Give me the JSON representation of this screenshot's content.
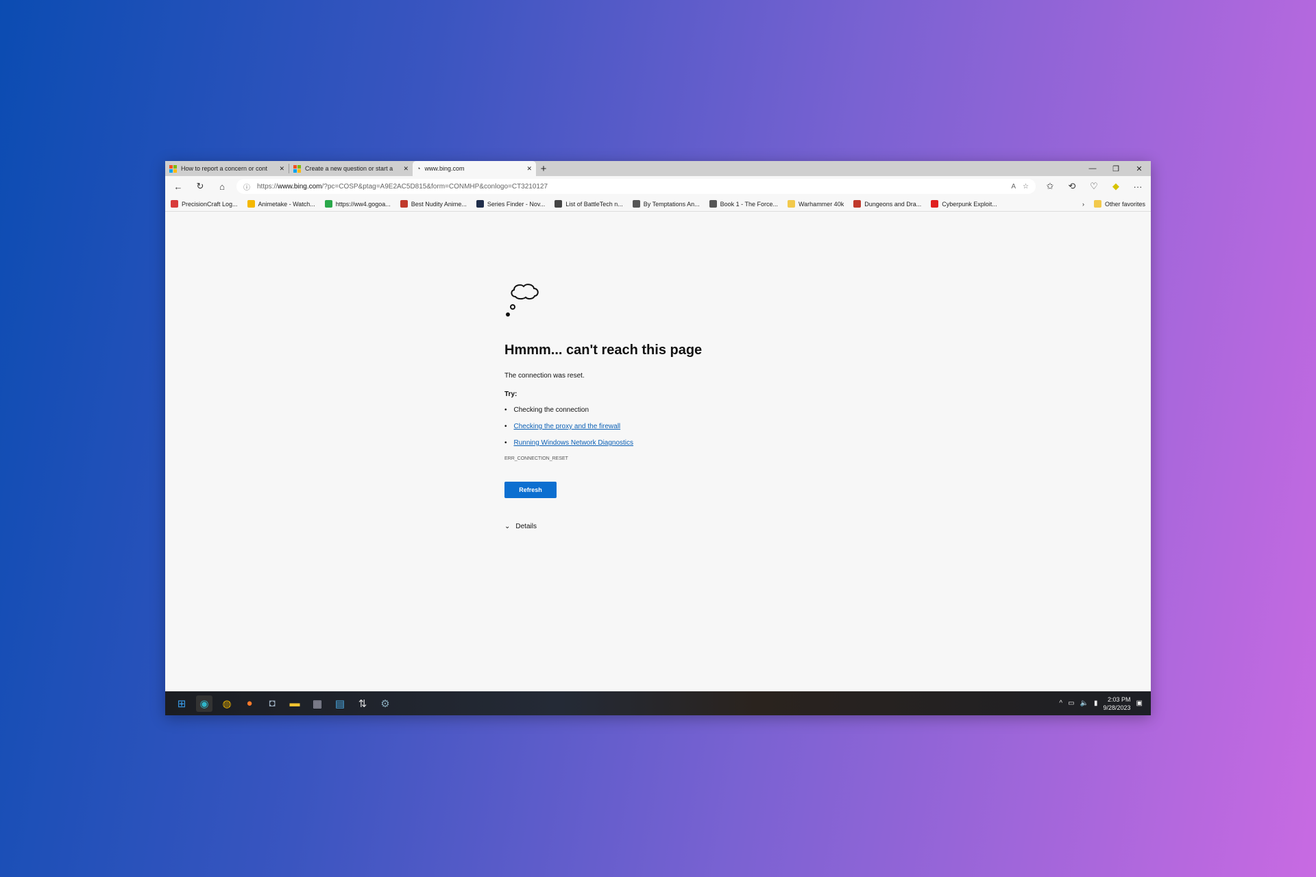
{
  "tabs": [
    {
      "title": "How to report a concern or cont",
      "icon": "microsoft-logo"
    },
    {
      "title": "Create a new question or start a",
      "icon": "microsoft-logo"
    },
    {
      "title": "www.bing.com",
      "icon": "error-page-icon",
      "active": true
    }
  ],
  "address": {
    "prefix": "https://",
    "host": "www.bing.com",
    "path": "/?pc=COSP&ptag=A9E2AC5D815&form=CONMHP&conlogo=CT3210127"
  },
  "bookmarks": [
    {
      "label": "PrecisionCraft Log...",
      "color": "#d83b3b"
    },
    {
      "label": "Animetake - Watch...",
      "color": "#f5b800"
    },
    {
      "label": "https://ww4.gogoa...",
      "color": "#2aa84a"
    },
    {
      "label": "Best Nudity Anime...",
      "color": "#c0392b"
    },
    {
      "label": "Series Finder - Nov...",
      "color": "#1f2d4a"
    },
    {
      "label": "List of BattleTech n...",
      "color": "#444444"
    },
    {
      "label": "By Temptations An...",
      "color": "#555555"
    },
    {
      "label": "Book 1 - The Force...",
      "color": "#555555"
    },
    {
      "label": "Warhammer 40k",
      "color": "#f2c94c"
    },
    {
      "label": "Dungeons and Dra...",
      "color": "#c0392b"
    },
    {
      "label": "Cyberpunk Exploit...",
      "color": "#e02020"
    }
  ],
  "other_favorites": "Other favorites",
  "error": {
    "title": "Hmmm... can't reach this page",
    "message": "The connection was reset.",
    "try_label": "Try:",
    "suggestions": [
      "Checking the connection",
      "Checking the proxy and the firewall",
      "Running Windows Network Diagnostics"
    ],
    "code": "ERR_CONNECTION_RESET",
    "refresh": "Refresh",
    "details": "Details"
  },
  "taskbar": {
    "time": "2:03 PM",
    "date": "9/28/2023"
  },
  "colors": {
    "accent": "#0c6fd0",
    "link": "#0a5fb5"
  }
}
